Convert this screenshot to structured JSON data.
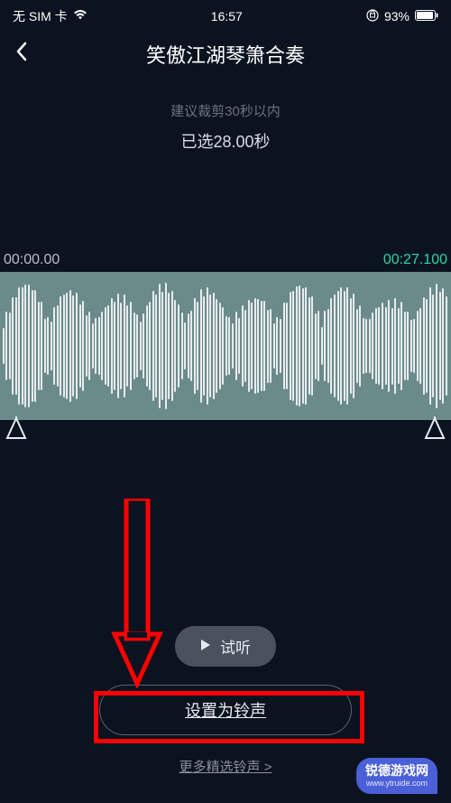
{
  "status": {
    "sim": "无 SIM 卡",
    "time": "16:57",
    "battery": "93%"
  },
  "header": {
    "title": "笑傲江湖琴箫合奏"
  },
  "info": {
    "hint": "建议裁剪30秒以内",
    "selected": "已选28.00秒"
  },
  "timeline": {
    "start": "00:00.00",
    "end": "00:27.100"
  },
  "buttons": {
    "preview": "试听",
    "set_ringtone": "设置为铃声",
    "more": "更多精选铃声 >"
  },
  "watermark": {
    "line1": "锐德游戏网",
    "line2": "www.ytruide.com"
  }
}
